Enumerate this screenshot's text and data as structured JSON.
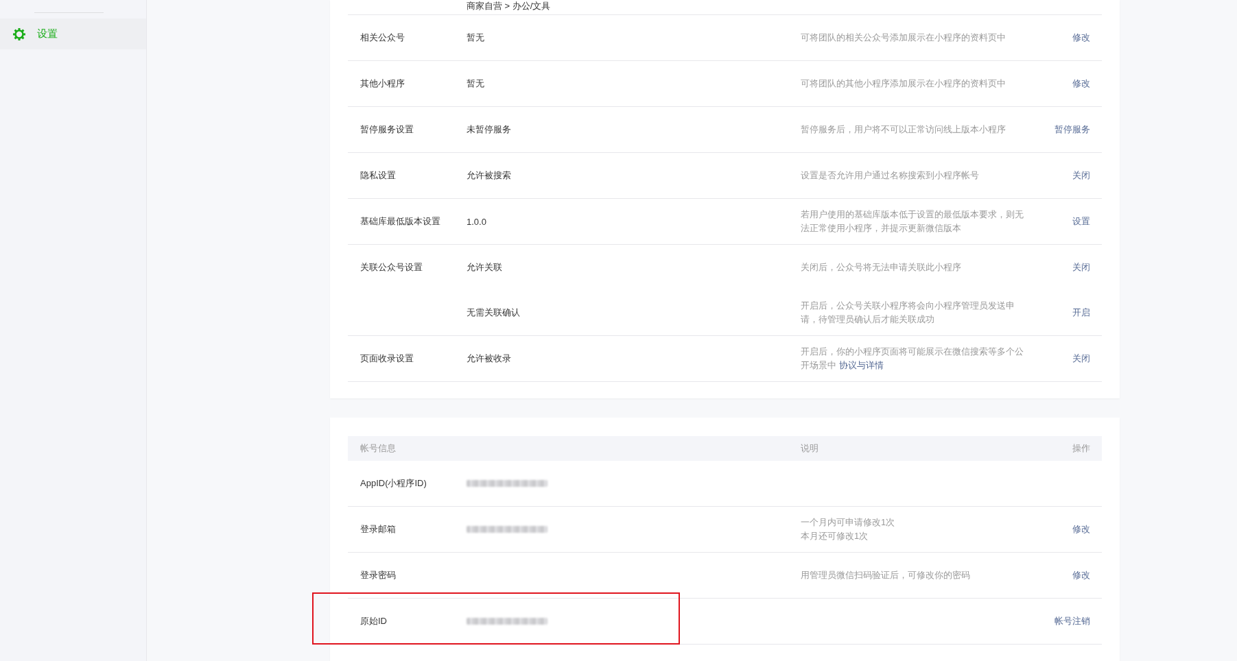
{
  "sidebar": {
    "items": [
      {
        "label": "设置",
        "selected": true
      }
    ]
  },
  "settings_card": {
    "breadcrumb": "商家自营 > 办公/文具",
    "rows": [
      {
        "label": "相关公众号",
        "entries": [
          {
            "value": "暂无",
            "description": "可将团队的相关公众号添加展示在小程序的资料页中",
            "action": "修改"
          }
        ]
      },
      {
        "label": "其他小程序",
        "entries": [
          {
            "value": "暂无",
            "description": "可将团队的其他小程序添加展示在小程序的资料页中",
            "action": "修改"
          }
        ]
      },
      {
        "label": "暂停服务设置",
        "entries": [
          {
            "value": "未暂停服务",
            "description": "暂停服务后，用户将不可以正常访问线上版本小程序",
            "action": "暂停服务"
          }
        ]
      },
      {
        "label": "隐私设置",
        "entries": [
          {
            "value": "允许被搜索",
            "description": "设置是否允许用户通过名称搜索到小程序帐号",
            "action": "关闭"
          }
        ]
      },
      {
        "label": "基础库最低版本设置",
        "entries": [
          {
            "value": "1.0.0",
            "description": "若用户使用的基础库版本低于设置的最低版本要求，则无法正常使用小程序，并提示更新微信版本",
            "action": "设置"
          }
        ]
      },
      {
        "label": "关联公众号设置",
        "entries": [
          {
            "value": "允许关联",
            "description": "关闭后，公众号将无法申请关联此小程序",
            "action": "关闭"
          },
          {
            "value": "无需关联确认",
            "description": "开启后，公众号关联小程序将会向小程序管理员发送申请，待管理员确认后才能关联成功",
            "action": "开启"
          }
        ]
      },
      {
        "label": "页面收录设置",
        "entries": [
          {
            "value": "允许被收录",
            "description": "开启后，你的小程序页面将可能展示在微信搜索等多个公开场景中 ",
            "description_link": "协议与详情",
            "action": "关闭"
          }
        ]
      }
    ]
  },
  "account_card": {
    "columns": [
      "帐号信息",
      "说明",
      "操作"
    ],
    "rows": [
      {
        "label": "AppID(小程序ID)",
        "redacted": true,
        "highlighted": false
      },
      {
        "label": "登录邮箱",
        "redacted": true,
        "description_lines": [
          "一个月内可申请修改1次",
          "本月还可修改1次"
        ],
        "action": "修改",
        "highlighted": false
      },
      {
        "label": "登录密码",
        "redacted": false,
        "description": "用管理员微信扫码验证后，可修改你的密码",
        "action": "修改",
        "highlighted": false
      },
      {
        "label": "原始ID",
        "redacted": true,
        "action": "帐号注销",
        "highlighted": true
      }
    ]
  }
}
